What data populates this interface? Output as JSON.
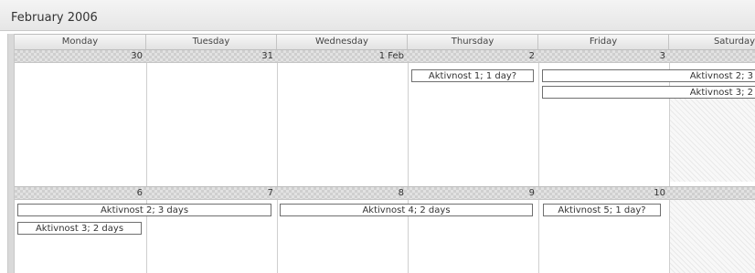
{
  "calendar": {
    "title": "February 2006",
    "weekdays": [
      "Monday",
      "Tuesday",
      "Wednesday",
      "Thursday",
      "Friday",
      "Saturday"
    ],
    "weeks": [
      {
        "dates": [
          "30",
          "31",
          "1 Feb",
          "2",
          "3",
          ""
        ]
      },
      {
        "dates": [
          "6",
          "7",
          "8",
          "9",
          "10",
          ""
        ]
      }
    ],
    "events": {
      "e1": "Aktivnost 1; 1 day?",
      "e2": "Aktivnost 2; 3",
      "e3": "Aktivnost 3; 2",
      "e4": "Aktivnost 2; 3 days",
      "e5": "Aktivnost 4; 2 days",
      "e6": "Aktivnost 5; 1 day?",
      "e7": "Aktivnost 3; 2 days"
    }
  }
}
